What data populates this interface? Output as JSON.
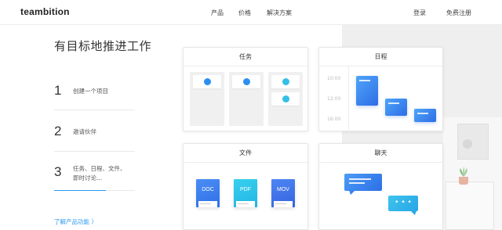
{
  "header": {
    "logo": "teambition",
    "nav": [
      "产品",
      "价格",
      "解决方案"
    ],
    "login": "登录",
    "signup": "免费注册"
  },
  "hero": {
    "headline": "有目标地推进工作",
    "steps": [
      {
        "num": "1",
        "text": "创建一个项目"
      },
      {
        "num": "2",
        "text": "邀请伙伴"
      },
      {
        "num": "3",
        "text": "任务、日程、文件、即时讨论..."
      }
    ],
    "more_link": "了解产品功能  〉"
  },
  "cards": {
    "tasks": {
      "title": "任务"
    },
    "schedule": {
      "title": "日程",
      "times": [
        "10:00",
        "12:00",
        "16:00"
      ]
    },
    "files": {
      "title": "文件",
      "types": [
        "DOC",
        "PDF",
        "MOV"
      ]
    },
    "chat": {
      "title": "聊天",
      "typing": "• • •"
    }
  },
  "colors": {
    "accent": "#2c98f0",
    "schedule_block": "#3b7ef0",
    "doc": "#3f7ff0",
    "pdf": "#25c3e8",
    "mov": "#3a6fe5"
  }
}
